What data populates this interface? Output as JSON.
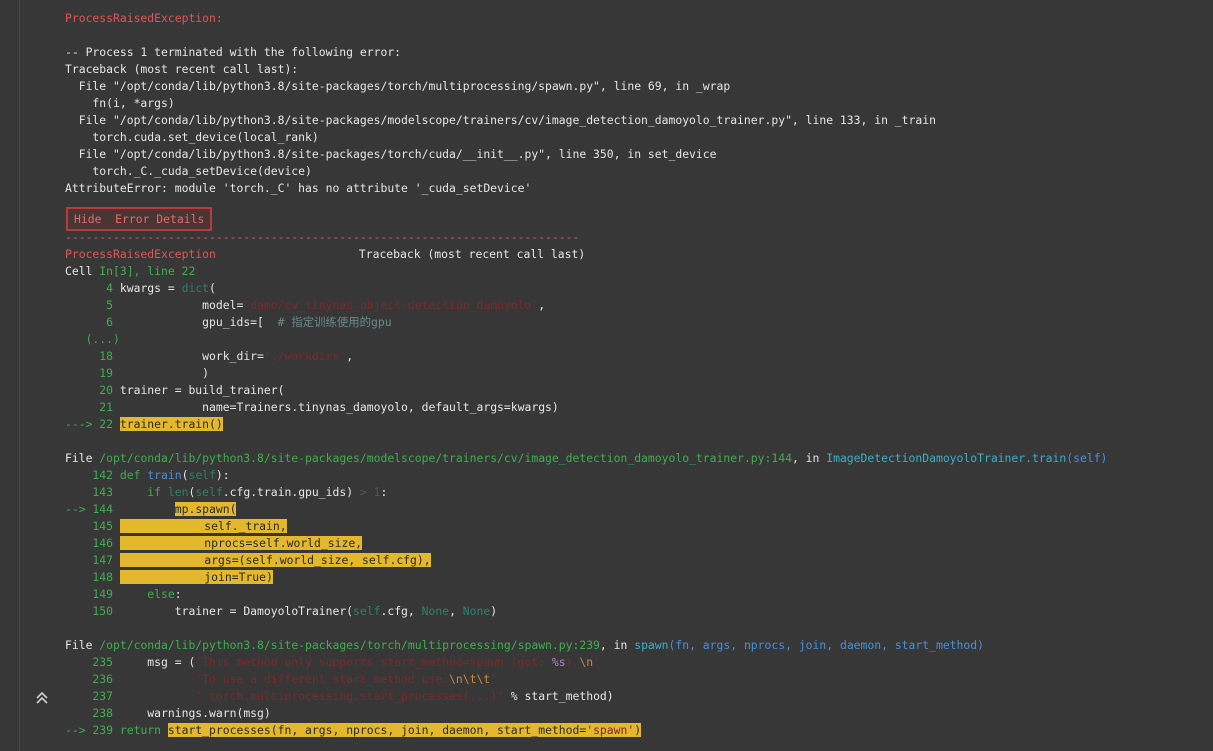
{
  "error_header": "ProcessRaisedException:",
  "top_trace": [
    "-- Process 1 terminated with the following error:",
    "Traceback (most recent call last):",
    "  File \"/opt/conda/lib/python3.8/site-packages/torch/multiprocessing/spawn.py\", line 69, in _wrap",
    "    fn(i, *args)",
    "  File \"/opt/conda/lib/python3.8/site-packages/modelscope/trainers/cv/image_detection_damoyolo_trainer.py\", line 133, in _train",
    "    torch.cuda.set_device(local_rank)",
    "  File \"/opt/conda/lib/python3.8/site-packages/torch/cuda/__init__.py\", line 350, in set_device",
    "    torch._C._cuda_setDevice(device)",
    "AttributeError: module 'torch._C' has no attribute '_cuda_setDevice'"
  ],
  "toggle_button": "Hide  Error Details",
  "separator": "---------------------------------------------------------------------------",
  "exception_name": "ProcessRaisedException",
  "exception_trace_label": "Traceback (most recent call last)",
  "cell": {
    "label": "Cell ",
    "ref": "In[3], line 22",
    "l4_num": "      4 ",
    "l4_code": "kwargs = ",
    "l4_fn": "dict",
    "l4_end": "(",
    "l5_num": "      5 ",
    "l5_a": "            model=",
    "l5_str": "'damo/cv_tinynas_object-detection_damoyolo'",
    "l5_b": ",",
    "l6_num": "      6 ",
    "l6_a": "            gpu_ids=[  ",
    "l6_comment": "# 指定训练使用的gpu",
    "ellipsis": "   (...)",
    "l18_num": "     18 ",
    "l18_a": "            work_dir=",
    "l18_str": "'./workdirs'",
    "l18_b": ",",
    "l19_num": "     19 ",
    "l19_a": "            )",
    "l20_num": "     20 ",
    "l20_a": "trainer = build_trainer(",
    "l21_num": "     21 ",
    "l21_a": "            name=Trainers.tinynas_damoyolo, default_args=kwargs)",
    "l22_arrow": "---> 22 ",
    "l22_hl": "trainer.train()"
  },
  "frame2": {
    "label": "File ",
    "path": "/opt/conda/lib/python3.8/site-packages/modelscope/trainers/cv/image_detection_damoyolo_trainer.py:144",
    "in": ", in ",
    "func": "ImageDetectionDamoyoloTrainer.train",
    "args": "(self)",
    "l142_num": "    142 ",
    "l142_kw": "def ",
    "l142_fn": "train",
    "l142_b": "(",
    "l142_self": "self",
    "l142_c": "):",
    "l143_num": "    143 ",
    "l143_kw": "    if ",
    "l143_fn": "len",
    "l143_b": "(",
    "l143_self": "self",
    "l143_c": ".cfg.train.gpu_ids) ",
    "l143_op": "> 1",
    "l143_d": ":",
    "l144_arrow": "--> 144 ",
    "l144_pad": "        ",
    "l144_hl": "mp.spawn(",
    "l145_num": "    145 ",
    "l145_hl": "    self._train,",
    "l146_num": "    146 ",
    "l146_hl": "    nprocs=self.world_size,",
    "l147_num": "    147 ",
    "l147_hl": "    args=(self.world_size, self.cfg),",
    "l148_num": "    148 ",
    "l148_hl": "    join=True)",
    "l149_num": "    149 ",
    "l149_kw": "    else",
    "l149_b": ":",
    "l150_num": "    150 ",
    "l150_a": "        trainer = DamoyoloTrainer(",
    "l150_self": "self",
    "l150_b": ".cfg, ",
    "l150_none1": "None",
    "l150_c": ", ",
    "l150_none2": "None",
    "l150_d": ")"
  },
  "frame3": {
    "label": "File ",
    "path": "/opt/conda/lib/python3.8/site-packages/torch/multiprocessing/spawn.py:239",
    "in": ", in ",
    "func": "spawn",
    "args": "(fn, args, nprocs, join, daemon, start_method)",
    "l235_num": "    235 ",
    "l235_a": "    msg = (",
    "l235_str": "'This method only supports start_method=spawn (got: ",
    "l235_fmt": "%s",
    "l235_str2": ").",
    "l235_esc": "\\n",
    "l235_end": "'",
    "l236_num": "    236 ",
    "l236_str": "           'To use a different start_method use:",
    "l236_esc": "\\n\\t\\t",
    "l236_end": "'",
    "l237_num": "    237 ",
    "l237_str": "           ' torch.multiprocessing.start_processes(...)'",
    "l237_b": " % start_method)",
    "l238_num": "    238 ",
    "l238_a": "    warnings.warn(msg)",
    "l239_arrow": "--> 239 ",
    "l239_kw": "return ",
    "l239_hl": "start_processes(fn, args, nprocs, join, daemon, start_method=",
    "l239_hl_str": "'spawn'",
    "l239_hl_end": ")"
  },
  "scroll_top_icon": "double-chevron-up-icon"
}
